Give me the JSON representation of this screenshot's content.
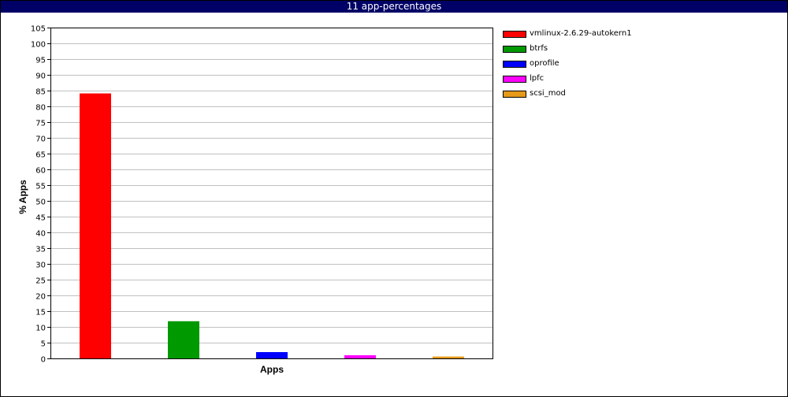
{
  "window": {
    "title": "11 app-percentages"
  },
  "colors": {
    "titlebar_bg": "#000066",
    "gridline": "#c0c0c0",
    "axis": "#000000"
  },
  "chart_data": {
    "type": "bar",
    "title": "11 app-percentages",
    "xlabel": "Apps",
    "ylabel": "% Apps",
    "ylim": [
      0,
      105
    ],
    "yticks": [
      0,
      5,
      10,
      15,
      20,
      25,
      30,
      35,
      40,
      45,
      50,
      55,
      60,
      65,
      70,
      75,
      80,
      85,
      90,
      95,
      100,
      105
    ],
    "grid": true,
    "legend_position": "right",
    "series": [
      {
        "name": "vmlinux-2.6.29-autokern1",
        "value": 84.1,
        "color": "#ff0000"
      },
      {
        "name": "btrfs",
        "value": 11.8,
        "color": "#009900"
      },
      {
        "name": "oprofile",
        "value": 2.0,
        "color": "#0000ff"
      },
      {
        "name": "lpfc",
        "value": 1.0,
        "color": "#ff00ff"
      },
      {
        "name": "scsi_mod",
        "value": 0.6,
        "color": "#e69a1a"
      }
    ]
  }
}
